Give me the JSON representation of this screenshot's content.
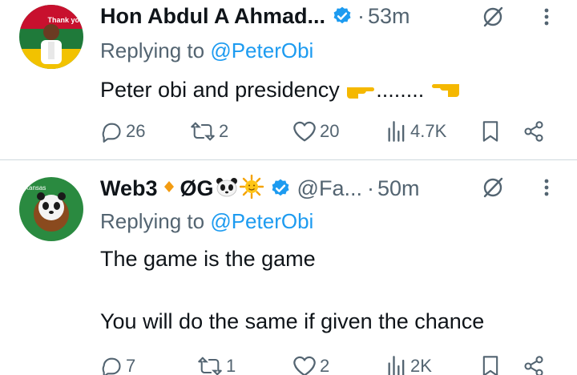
{
  "tweets": [
    {
      "author_name": "Hon Abdul A Ahmad...",
      "handle": "",
      "dot": "·",
      "time": "53m",
      "replying_prefix": "Replying to",
      "replying_handle": "@PeterObi",
      "text": "Peter obi and presidency",
      "text_suffix": "........",
      "avatar_text": "Thank you",
      "stats": {
        "replies": "26",
        "reposts": "2",
        "likes": "20",
        "views": "4.7K"
      }
    },
    {
      "author_name": "Web3",
      "name_suffix": "ØG",
      "handle": "@Fa...",
      "dot": "·",
      "time": "50m",
      "replying_prefix": "Replying to",
      "replying_handle": "@PeterObi",
      "text_line1": "The game is the game",
      "text_line2": "You will do the same if given the chance",
      "avatar_text": "Kansas",
      "stats": {
        "replies": "7",
        "reposts": "1",
        "likes": "2",
        "views": "2K"
      }
    }
  ],
  "colors": {
    "verified": "#1d9bf0",
    "secondary_text": "#536471",
    "mention": "#1d9bf0",
    "divider": "#cfd9de"
  },
  "icons": [
    "verified-badge-icon",
    "grok-icon",
    "more-icon",
    "reply-icon",
    "repost-icon",
    "like-icon",
    "views-icon",
    "bookmark-icon",
    "share-icon",
    "pointing-hand-emoji",
    "panda-emoji",
    "sun-emoji",
    "orange-diamond-emoji"
  ]
}
